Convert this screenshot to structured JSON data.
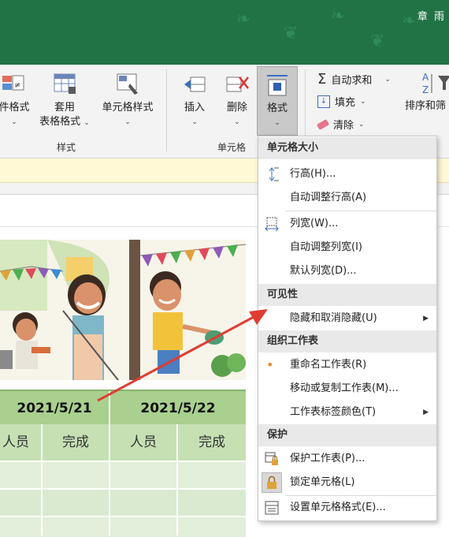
{
  "titlebar": {
    "user_name": "章 雨"
  },
  "ribbon": {
    "conditional_format_label": "件格式",
    "format_as_table_label_1": "套用",
    "format_as_table_label_2": "表格格式",
    "cell_styles_label": "单元格样式",
    "styles_group_label": "样式",
    "insert_label": "插入",
    "delete_label": "删除",
    "format_label": "格式",
    "cells_group_label": "单元格",
    "autosum_label": "自动求和",
    "fill_label": "填充",
    "clear_label": "清除",
    "sort_filter_label": "排序和筛"
  },
  "sheet": {
    "dates": [
      "2021/5/21",
      "2021/5/22"
    ],
    "headers": [
      "人员",
      "完成",
      "人员",
      "完成"
    ]
  },
  "menu": {
    "sections": {
      "cell_size": "单元格大小",
      "visibility": "可见性",
      "organize": "组织工作表",
      "protection": "保护"
    },
    "items": {
      "row_height": "行高(H)...",
      "autofit_row": "自动调整行高(A)",
      "column_width": "列宽(W)...",
      "autofit_column": "自动调整列宽(I)",
      "default_width": "默认列宽(D)...",
      "hide_unhide": "隐藏和取消隐藏(U)",
      "rename_sheet": "重命名工作表(R)",
      "move_copy_sheet": "移动或复制工作表(M)...",
      "tab_color": "工作表标签颜色(T)",
      "protect_sheet": "保护工作表(P)...",
      "lock_cell": "锁定单元格(L)",
      "format_cells": "设置单元格格式(E)..."
    }
  },
  "colors": {
    "title_green": "#217346",
    "date_row": "#a9d08e",
    "header_row": "#c6e0b4",
    "arrow_red": "#e03c31"
  }
}
